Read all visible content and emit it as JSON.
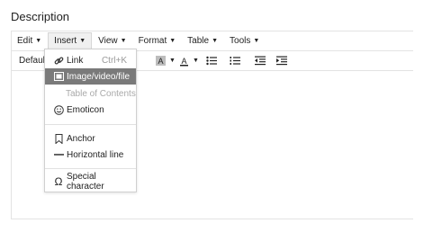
{
  "title": "Description",
  "menubar": {
    "items": [
      {
        "label": "Edit"
      },
      {
        "label": "Insert"
      },
      {
        "label": "View"
      },
      {
        "label": "Format"
      },
      {
        "label": "Table"
      },
      {
        "label": "Tools"
      }
    ]
  },
  "toolbar": {
    "format_select": "Default",
    "buttons": [
      "highlight-color-icon",
      "text-color-icon",
      "bullet-list-icon",
      "numbered-list-icon",
      "outdent-icon",
      "indent-icon"
    ]
  },
  "insert_menu": {
    "link": {
      "label": "Link",
      "shortcut": "Ctrl+K",
      "icon": "link-icon"
    },
    "media": {
      "label": "Image/video/file",
      "icon": "image-icon"
    },
    "toc": {
      "label": "Table of Contents"
    },
    "emoticon": {
      "label": "Emoticon",
      "icon": "smiley-icon"
    },
    "anchor": {
      "label": "Anchor",
      "icon": "bookmark-icon"
    },
    "hr": {
      "label": "Horizontal line",
      "icon": "horizontal-line-icon"
    },
    "special": {
      "label": "Special character",
      "icon": "omega-icon"
    }
  },
  "colors": {
    "selected_item_bg": "#7a7a7a",
    "border": "#e3e3e3",
    "disabled_text": "#a9a9a9"
  }
}
